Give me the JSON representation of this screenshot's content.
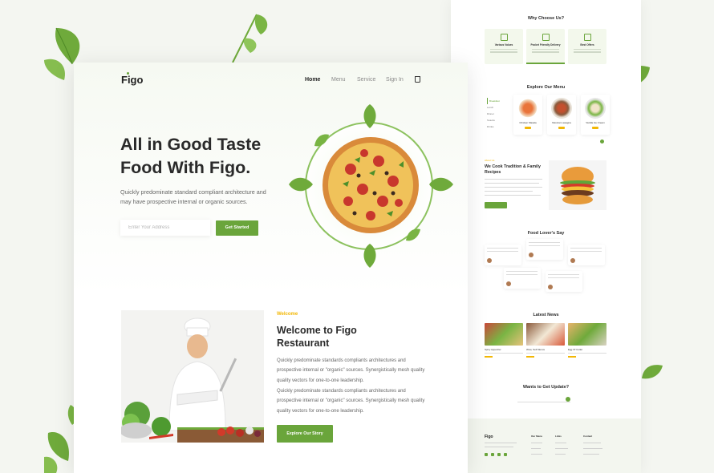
{
  "brand": {
    "logo": "Figo",
    "accent": "#6aa53b",
    "highlight": "#f2b705"
  },
  "nav": {
    "items": [
      {
        "label": "Home",
        "active": true
      },
      {
        "label": "Menu",
        "active": false
      },
      {
        "label": "Service",
        "active": false
      },
      {
        "label": "Sign In",
        "active": false
      }
    ],
    "cart_icon": "shopping-bag-icon"
  },
  "hero": {
    "title": "All in Good Taste Food With Figo.",
    "subtitle": "Quickly predominate standard compliant architecture and may have prospective internal or organic sources.",
    "address_placeholder": "Enter Your Address",
    "cta": "Get Started"
  },
  "welcome": {
    "eyebrow": "Welcome",
    "title": "Welcome to Figo Restaurant",
    "paragraphs": [
      "Quickly predominate standards compliants architectures and prospective internal or \"organic\" sources. Synergistically mesh quality quality vectors for one-to-one leadership.",
      "Quickly predominate standards compliants architectures and prospective internal or \"organic\" sources. Synergistically mesh quality quality vectors for one-to-one leadership."
    ],
    "cta": "Explore Our Story"
  },
  "preview": {
    "why": {
      "title": "Why Choose Us?",
      "cards": [
        "Various Values",
        "Pocket Friendly Delivery",
        "Best Offers"
      ]
    },
    "menu": {
      "title": "Explore Our Menu",
      "categories": [
        "Breakfast",
        "Lunch",
        "Dinner",
        "Snacks",
        "Drinks"
      ],
      "dishes": [
        "Chicken Masala",
        "Mexican Lasagna",
        "Vanilla Ice Cream"
      ]
    },
    "cook": {
      "eyebrow": "About Us",
      "title": "We Cook Tradition & Family Recipes"
    },
    "testimonials": {
      "title": "Food Lover's Say"
    },
    "news": {
      "title": "Latest News",
      "items": [
        "Spicy Appetizer",
        "Wow, Sell Menus",
        "Egg Of Cutlet"
      ]
    },
    "newsletter": {
      "title": "Wants to Get Update?"
    },
    "footer": {
      "logo": "Figo",
      "columns": [
        "Our Menu",
        "Links",
        "Contact"
      ]
    }
  }
}
